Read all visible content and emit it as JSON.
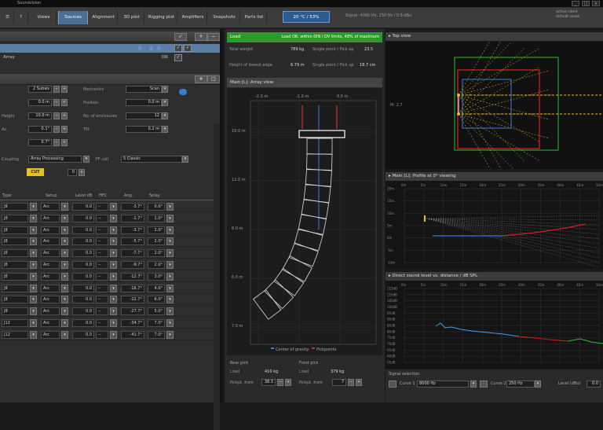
{
  "titlebar": {
    "title": "Soundvision"
  },
  "toolbar": {
    "buttons": [
      "Views",
      "Sources",
      "Alignment",
      "3D plot",
      "Rigging plot",
      "Amplifiers",
      "Snapshots",
      "Parts list"
    ],
    "active": "Sources",
    "help_icon": "question-icon",
    "temperature": "20 °C / 53%",
    "signal_text": "Signal: 4000 Hz, 250 Hz / 0.8 dBu",
    "right_lines": [
      "active client",
      "default views"
    ]
  },
  "left": {
    "sources": [
      {
        "name": "",
        "status": "",
        "selected": true
      },
      {
        "name": "Array",
        "status": "OK",
        "selected": false
      }
    ],
    "params": [
      {
        "label": "",
        "value": "2 Subws",
        "label2": "Mechanics",
        "value2": "Scan"
      },
      {
        "label": "",
        "value": "0.0 m",
        "label2": "Position",
        "value2": "0.0 m"
      },
      {
        "label": "Height",
        "value": "10.0 m",
        "label2": "No. of enclosures",
        "value2": "12"
      },
      {
        "label": "Az.",
        "value": "0.1°",
        "label2": "Tilt",
        "value2": "0.2 m"
      },
      {
        "label": "",
        "value": "0.7°",
        "label2": "",
        "value2": ""
      }
    ],
    "processing": {
      "label": "Coupling",
      "value": "Array Processing",
      "label2": "FF coil",
      "value2": "5 Classic"
    },
    "cut": {
      "button": "CUT",
      "value": "0"
    },
    "table_headers": [
      "Type",
      "Setup",
      "Level dB",
      "HFC",
      "Ang.",
      "Splay"
    ],
    "rows": [
      {
        "type": "J8",
        "setup": "Arc",
        "level": "0.0",
        "hfc": "--",
        "ang": "-3.7°",
        "splay": "0.0°"
      },
      {
        "type": "J8",
        "setup": "Arc",
        "level": "0.0",
        "hfc": "--",
        "ang": "-1.7°",
        "splay": "1.0°"
      },
      {
        "type": "J8",
        "setup": "Arc",
        "level": "0.0",
        "hfc": "--",
        "ang": "-3.7°",
        "splay": "2.0°"
      },
      {
        "type": "J8",
        "setup": "Arc",
        "level": "0.0",
        "hfc": "--",
        "ang": "-5.7°",
        "splay": "2.0°"
      },
      {
        "type": "J8",
        "setup": "Arc",
        "level": "0.0",
        "hfc": "--",
        "ang": "-7.7°",
        "splay": "2.0°"
      },
      {
        "type": "J8",
        "setup": "Arc",
        "level": "0.0",
        "hfc": "--",
        "ang": "-9.7°",
        "splay": "2.0°"
      },
      {
        "type": "J8",
        "setup": "Arc",
        "level": "0.0",
        "hfc": "--",
        "ang": "-12.7°",
        "splay": "3.0°"
      },
      {
        "type": "J8",
        "setup": "Arc",
        "level": "0.0",
        "hfc": "--",
        "ang": "-16.7°",
        "splay": "4.0°"
      },
      {
        "type": "J8",
        "setup": "Arc",
        "level": "0.0",
        "hfc": "--",
        "ang": "-22.7°",
        "splay": "6.0°"
      },
      {
        "type": "J8",
        "setup": "Arc",
        "level": "0.0",
        "hfc": "--",
        "ang": "-27.7°",
        "splay": "5.0°"
      },
      {
        "type": "J12",
        "setup": "Arc",
        "level": "0.0",
        "hfc": "--",
        "ang": "-34.7°",
        "splay": "7.0°"
      },
      {
        "type": "J12",
        "setup": "Arc",
        "level": "0.0",
        "hfc": "--",
        "ang": "-41.7°",
        "splay": "7.0°"
      }
    ]
  },
  "middle": {
    "load": {
      "label": "Load",
      "status": "Load OK: within DIN / DV limits, 48% of maximum"
    },
    "weights": [
      {
        "label": "Total weight",
        "value": "789 kg",
        "label2": "Single point / Pick up",
        "value2": "23.5"
      },
      {
        "label": "Height of lowest edge",
        "value": "6.79 m",
        "label2": "Single point / Pick up",
        "value2": "18.7 cm"
      }
    ],
    "array_title": "Main [L]: Array view",
    "array_x_ticks": [
      "-2.0 m",
      "-1.0 m",
      "0.0 m"
    ],
    "array_y_ticks": [
      "10.0 m",
      "12.0 m",
      "8.0 m",
      "6.0 m",
      "7.0 m"
    ],
    "legend": [
      "Center of gravity",
      "Pickpoints"
    ],
    "rear": {
      "title": "Rear pick",
      "load_label": "Load",
      "load": "410 kg",
      "pos_label": "Pickpt. from",
      "pos": "38.3"
    },
    "front": {
      "title": "Front pick",
      "load_label": "Load",
      "load": "379 kg",
      "pos_label": "Pickpt. from",
      "pos": "7"
    }
  },
  "right": {
    "top_view_title": "Top view",
    "top_view_label": "M: 2.7",
    "profile_title": "Main [L]: Profile at 0° viewing",
    "profile_x_ticks": [
      "0m",
      "5m",
      "10m",
      "15m",
      "20m",
      "25m",
      "30m",
      "35m",
      "40m",
      "45m",
      "50m"
    ],
    "profile_y_ticks": [
      "20m",
      "15m",
      "10m",
      "5m",
      "0m",
      "-5m",
      "-10m"
    ],
    "spl_title": "Direct sound level vs. distance / dB SPL",
    "spl_x_ticks": [
      "0m",
      "5m",
      "10m",
      "15m",
      "20m",
      "25m",
      "30m",
      "35m",
      "40m",
      "45m",
      "50m"
    ],
    "spl_y_ticks": [
      "115dB",
      "110dB",
      "105dB",
      "100dB",
      "95dB",
      "90dB",
      "85dB",
      "80dB",
      "75dB",
      "70dB",
      "65dB",
      "60dB",
      "55dB"
    ],
    "signal_selection": {
      "title": "Signal selection",
      "curve1_label": "Curve 1",
      "curve1": "8000 Hz",
      "curve2_label": "Curve 2",
      "curve2": "250 Hz",
      "level_label": "Level (dBu)",
      "level": "0.0"
    }
  },
  "colors": {
    "accent": "#4a6e96",
    "load_ok": "#2e9a2e",
    "cut": "#e8c020"
  }
}
